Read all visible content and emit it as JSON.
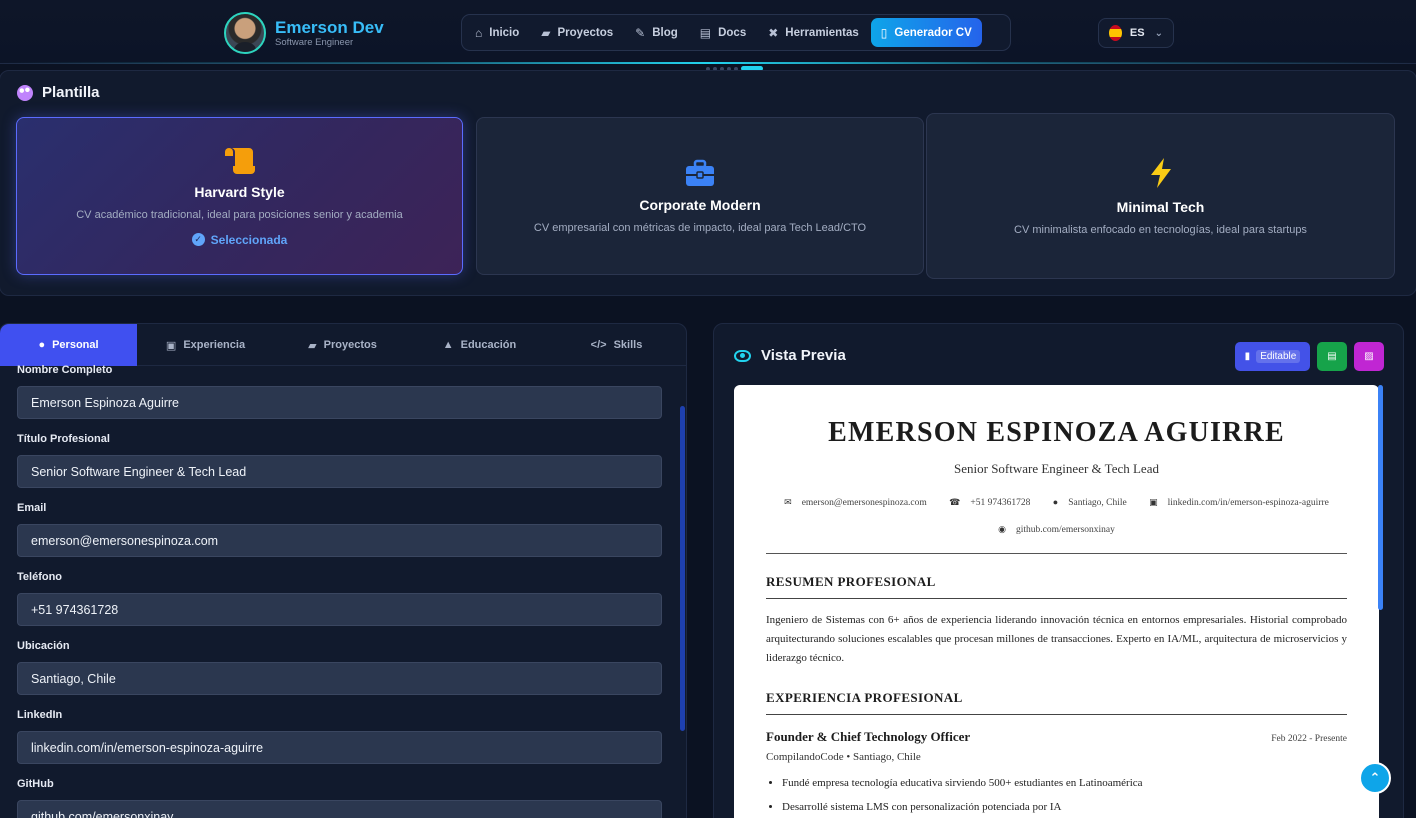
{
  "brand": {
    "name": "Emerson Dev",
    "subtitle": "Software Engineer"
  },
  "nav": {
    "items": [
      {
        "label": "Inicio",
        "icon": "⌂"
      },
      {
        "label": "Proyectos",
        "icon": "▰"
      },
      {
        "label": "Blog",
        "icon": "✎"
      },
      {
        "label": "Docs",
        "icon": "▤"
      },
      {
        "label": "Herramientas",
        "icon": "✖"
      },
      {
        "label": "Generador CV",
        "icon": "▯"
      }
    ],
    "active_index": 5
  },
  "language": {
    "code": "ES"
  },
  "templates": {
    "section_title": "Plantilla",
    "cards": [
      {
        "name": "Harvard Style",
        "desc": "CV académico tradicional, ideal para posiciones senior y academia",
        "selected_label": "Seleccionada",
        "icon": "scroll-icon",
        "icon_color": "#f59e0b"
      },
      {
        "name": "Corporate Modern",
        "desc": "CV empresarial con métricas de impacto, ideal para Tech Lead/CTO",
        "icon": "briefcase-icon",
        "icon_color": "#3b82f6"
      },
      {
        "name": "Minimal Tech",
        "desc": "CV minimalista enfocado en tecnologías, ideal para startups",
        "icon": "bolt-icon",
        "icon_color": "#facc15"
      }
    ]
  },
  "form": {
    "tabs": [
      "Personal",
      "Experiencia",
      "Proyectos",
      "Educación",
      "Skills"
    ],
    "active_tab": 0,
    "fields": [
      {
        "label": "Nombre Completo",
        "value": "Emerson Espinoza Aguirre"
      },
      {
        "label": "Título Profesional",
        "value": "Senior Software Engineer & Tech Lead"
      },
      {
        "label": "Email",
        "value": "emerson@emersonespinoza.com"
      },
      {
        "label": "Teléfono",
        "value": "+51 974361728"
      },
      {
        "label": "Ubicación",
        "value": "Santiago, Chile"
      },
      {
        "label": "LinkedIn",
        "value": "linkedin.com/in/emerson-espinoza-aguirre"
      },
      {
        "label": "GitHub",
        "value": "github.com/emersonxinay"
      }
    ]
  },
  "preview": {
    "title": "Vista Previa",
    "editable_label": "Editable",
    "cv": {
      "name": "EMERSON ESPINOZA AGUIRRE",
      "title": "Senior Software Engineer & Tech Lead",
      "email": "emerson@emersonespinoza.com",
      "phone": "+51 974361728",
      "location": "Santiago, Chile",
      "linkedin": "linkedin.com/in/emerson-espinoza-aguirre",
      "github": "github.com/emersonxinay",
      "summary_heading": "RESUMEN PROFESIONAL",
      "summary": "Ingeniero de Sistemas con 6+ años de experiencia liderando innovación técnica en entornos empresariales. Historial comprobado arquitecturando soluciones escalables que procesan millones de transacciones. Experto en IA/ML, arquitectura de microservicios y liderazgo técnico.",
      "experience_heading": "EXPERIENCIA PROFESIONAL",
      "job": {
        "title": "Founder & Chief Technology Officer",
        "dates": "Feb 2022 - Presente",
        "company": "CompilandoCode • Santiago, Chile",
        "bullets": [
          "Fundé empresa tecnología educativa sirviendo 500+ estudiantes en Latinoamérica",
          "Desarrollé sistema LMS con personalización potenciada por IA"
        ]
      }
    }
  }
}
